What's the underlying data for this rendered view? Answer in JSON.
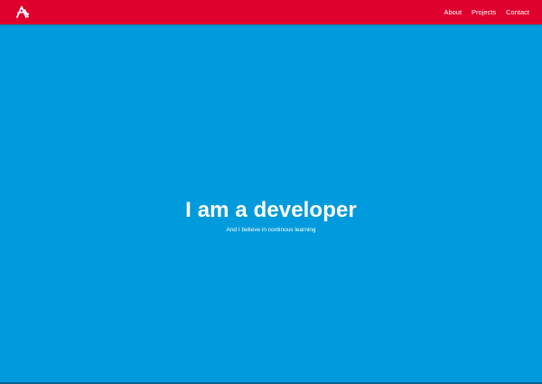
{
  "colors": {
    "navbar_background": "#e0002e",
    "page_background": "#009bdc",
    "text": "#ffffff"
  },
  "navbar": {
    "logo_icon": "a-monogram-logo-icon",
    "links": [
      {
        "label": "About"
      },
      {
        "label": "Projects"
      },
      {
        "label": "Contact"
      }
    ]
  },
  "hero": {
    "title": "I am a developer",
    "subtitle": "And I believe in continous learning"
  }
}
